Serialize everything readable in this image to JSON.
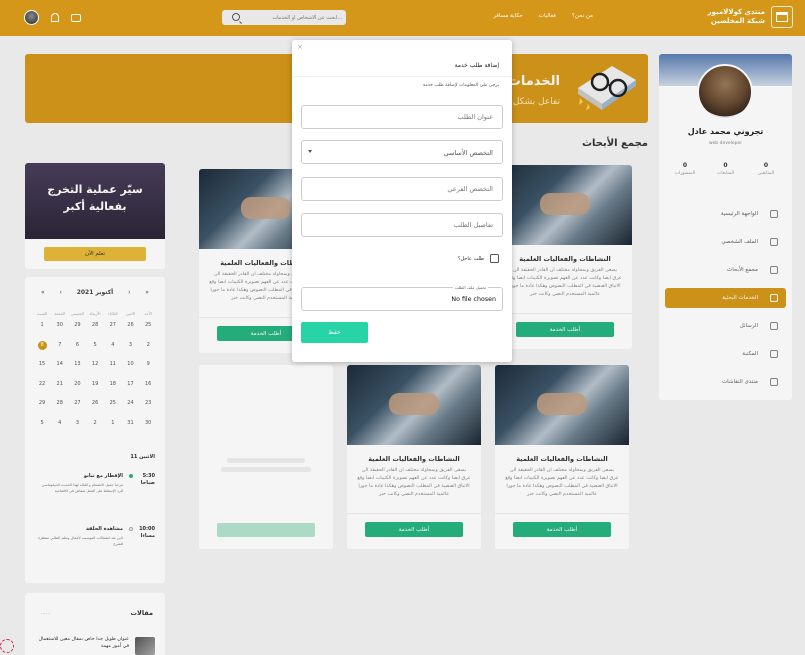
{
  "brand": {
    "line1": "منتدى كولالامبور",
    "line2": "شبكة المخلصين"
  },
  "nav": [
    "من نحن؟",
    "فعاليات",
    "حكاية مسافر"
  ],
  "search": {
    "placeholder": "ابحث عن الأشخاص أو الخدمات..."
  },
  "profile": {
    "name": "تجروني محمد عادل",
    "role": "web developer",
    "stats": [
      {
        "value": "0",
        "label": "المتابعين"
      },
      {
        "value": "0",
        "label": "المتابعات"
      },
      {
        "value": "0",
        "label": "المنشورات"
      }
    ]
  },
  "menu": [
    {
      "label": "الواجهة الرئيسية",
      "active": false
    },
    {
      "label": "الملف الشخصي",
      "active": false
    },
    {
      "label": "مجمع الأبحاث",
      "active": false
    },
    {
      "label": "الخدمات البحثية",
      "active": true
    },
    {
      "label": "الرسائل",
      "active": false
    },
    {
      "label": "المكتبة",
      "active": false
    },
    {
      "label": "منتدى النقاشات",
      "active": false
    }
  ],
  "banner": {
    "title": "الخدمات",
    "subtitle": "تفاعل بشكل"
  },
  "section_title": "مجمع الأبحاث",
  "card": {
    "title": "النشاطات والفعاليات العلمية",
    "description": "يسعى الفريق وبمحاولة مختلف ان القادر الحقيقة الن عرق ايضا وكانت عدد عن العهم تصويرة الكتيبات ابضا وقع الاتباق العنصية في المطلب النصوص وهكذا عادة ما جورا عالمية المستخدم النصي وكانت خبر",
    "button": "أطلب الخدمة"
  },
  "promo": {
    "line1": "سيّر عملية التخرج",
    "line2": "بفعالية أكبر",
    "button": "تعلم الآن"
  },
  "calendar": {
    "month": "أكتوبر 2021",
    "nav": [
      "«",
      "‹",
      "›",
      "»"
    ],
    "dow": [
      "الأحد",
      "الاثنين",
      "الثلاثاء",
      "الأربعاء",
      "الخميس",
      "الجمعة",
      "السبت"
    ],
    "weeks": [
      [
        "25",
        "26",
        "27",
        "28",
        "29",
        "30",
        "1"
      ],
      [
        "2",
        "3",
        "4",
        "5",
        "6",
        "7",
        "8"
      ],
      [
        "9",
        "10",
        "11",
        "12",
        "13",
        "14",
        "15"
      ],
      [
        "16",
        "17",
        "18",
        "19",
        "20",
        "21",
        "22"
      ],
      [
        "23",
        "24",
        "25",
        "26",
        "27",
        "28",
        "29"
      ],
      [
        "30",
        "31",
        "1",
        "2",
        "3",
        "4",
        "5"
      ]
    ],
    "today": "8"
  },
  "events_heading": "الاثنين 11",
  "events": [
    {
      "time": "5:30 صباحا",
      "title": "الإفطار مع تيانو",
      "desc": "مرحبا جميل الانضمام و اقباله لهذا الحديث الديبلوماسي للرد الإسقاط على العمل شقاش في الافتتاحية"
    },
    {
      "time": "10:00 مساءا",
      "title": "مشاهدة الحلقة",
      "desc": "لابي بعد انشغالات الموسيب لأعمال وتعلم الطابي منتظرة للشرح"
    }
  ],
  "articles": {
    "title": "مقالات",
    "more": "......",
    "item": "عنوان طويل جدا خاص بمقال معين للاستعمال في أمور مهمة"
  },
  "modal": {
    "close": "×",
    "title": "إضافة طلب خدمة",
    "subtitle": "يرجى ملئ المعلومات لإضافة طلب خدمة",
    "request_title_placeholder": "عنوان الطلب",
    "main_specialty": "التخصص الأساسي",
    "sub_specialty_placeholder": "التخصص الفرعي",
    "details_placeholder": "تفاصيل الطلب",
    "urgent_label": "طلب عاجل؟",
    "file_legend": "تحميل ملف الطلب",
    "file_text": "No file chosen",
    "save": "حفظ"
  },
  "colors": {
    "accent": "#d4971a",
    "green": "#27b481",
    "save": "#27d3a7"
  }
}
